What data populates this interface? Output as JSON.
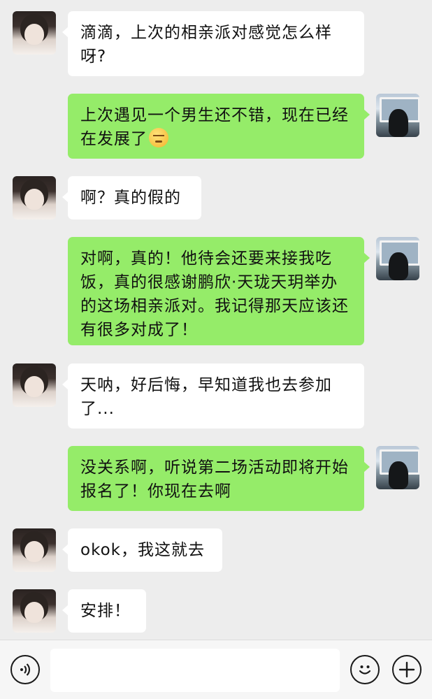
{
  "messages": [
    {
      "side": "left",
      "text": "滴滴，上次的相亲派对感觉怎么样呀?"
    },
    {
      "side": "right",
      "text": "上次遇见一个男生还不错，现在已经在发展了",
      "emoji": "smirk-emoji"
    },
    {
      "side": "left",
      "text": "啊？真的假的"
    },
    {
      "side": "right",
      "text": "对啊，真的！他待会还要来接我吃饭，真的很感谢鹏欣·天珑天玥举办的这场相亲派对。我记得那天应该还有很多对成了！"
    },
    {
      "side": "left",
      "text": "天呐，好后悔，早知道我也去参加了..."
    },
    {
      "side": "right",
      "text": "没关系啊，听说第二场活动即将开始报名了！你现在去啊"
    },
    {
      "side": "left",
      "text": "okok，我这就去"
    },
    {
      "side": "left",
      "text": "安排！"
    }
  ],
  "input_bar": {
    "voice_icon": "voice-icon",
    "emoji_icon": "emoji-icon",
    "plus_icon": "plus-icon",
    "input_value": ""
  }
}
